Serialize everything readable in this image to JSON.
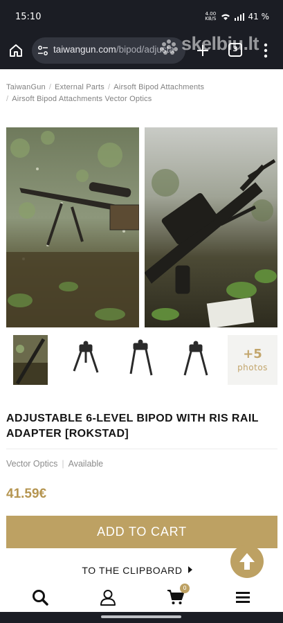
{
  "status_bar": {
    "time": "15:10",
    "net_speed": "4.00",
    "net_unit": "KB/S",
    "battery": "41 %"
  },
  "browser": {
    "url_domain": "taiwangun.com",
    "url_path": "/bipod/adjusta",
    "tab_count": "3",
    "watermark": "skelbiu.lt"
  },
  "breadcrumb": {
    "items": [
      "TaiwanGun",
      "External Parts",
      "Airsoft Bipod Attachments",
      "Airsoft Bipod Attachments Vector Optics"
    ]
  },
  "gallery": {
    "more_count": "+5",
    "more_label": "photos"
  },
  "product": {
    "title": "ADJUSTABLE 6-LEVEL BIPOD WITH RIS RAIL ADAPTER [ROKSTAD]",
    "brand": "Vector Optics",
    "availability": "Available",
    "price": "41.59€",
    "add_to_cart": "ADD TO CART",
    "clipboard": "TO THE CLIPBOARD"
  },
  "bottom_nav": {
    "cart_count": "0"
  },
  "colors": {
    "accent": "#bda163",
    "price": "#b59550",
    "chrome": "#1b1d24"
  }
}
